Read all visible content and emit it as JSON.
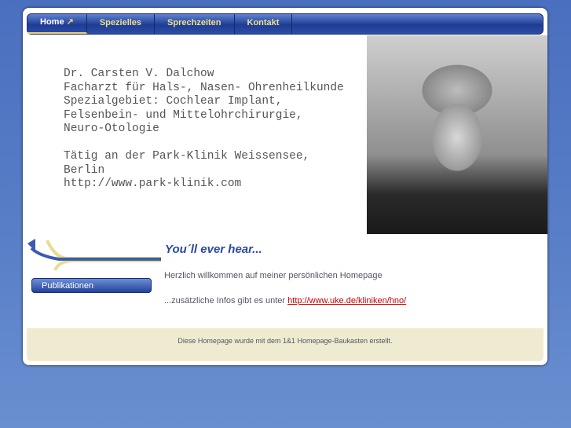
{
  "nav": [
    "Home",
    "Spezielles",
    "Sprechzeiten",
    "Kontakt"
  ],
  "bio": "Dr. Carsten V. Dalchow\nFacharzt für Hals-, Nasen- Ohrenheilkunde\nSpezialgebiet: Cochlear Implant,\nFelsenbein- und Mittelohrchirurgie,\nNeuro-Otologie\n\nTätig an der Park-Klinik Weissensee,\nBerlin\nhttp://www.park-klinik.com",
  "sidebar": {
    "button": "Publikationen"
  },
  "main": {
    "title": "You´ll ever hear...",
    "welcome": "Herzlich willkommen auf meiner persönlichen Homepage",
    "info_prefix": "...zusätzliche Infos gibt es unter ",
    "info_link": "http://www.uke.de/kliniken/hno/"
  },
  "footer": "Diese Homepage wurde mit dem 1&1 Homepage-Baukasten erstellt."
}
